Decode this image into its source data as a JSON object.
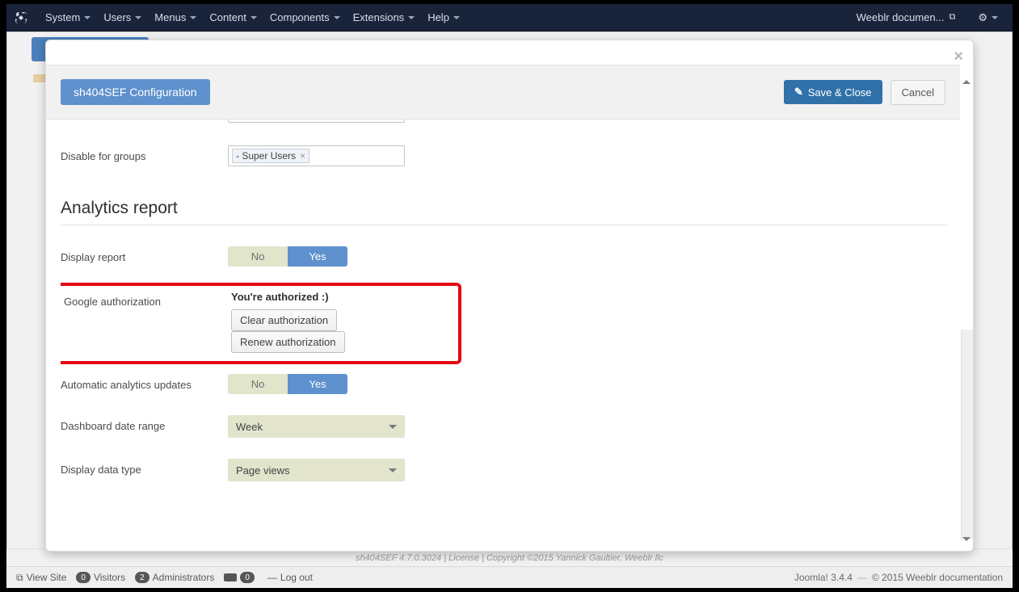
{
  "nav": {
    "items": [
      "System",
      "Users",
      "Menus",
      "Content",
      "Components",
      "Extensions",
      "Help"
    ],
    "right_label": "Weeblr documen...",
    "gear_icon": "gear-icon"
  },
  "modal": {
    "title_button": "sh404SEF Configuration",
    "save_close": "Save & Close",
    "cancel": "Cancel"
  },
  "form": {
    "disable_for_groups": {
      "label": "Disable for groups",
      "token": "- Super Users",
      "token_x": "×"
    },
    "section_heading": "Analytics report",
    "display_report": {
      "label": "Display report",
      "no": "No",
      "yes": "Yes"
    },
    "google_auth": {
      "label": "Google authorization",
      "status": "You're authorized :)",
      "clear": "Clear authorization",
      "renew": "Renew authorization"
    },
    "auto_updates": {
      "label": "Automatic analytics updates",
      "no": "No",
      "yes": "Yes"
    },
    "dash_range": {
      "label": "Dashboard date range",
      "value": "Week"
    },
    "data_type": {
      "label": "Display data type",
      "value": "Page views"
    }
  },
  "footer": {
    "info_line": "sh404SEF 4.7.0.3024 | License | Copyright ©2015 Yannick Gaultier, Weeblr llc",
    "view_site": "View Site",
    "visitors_count": "0",
    "visitors": "Visitors",
    "admins_count": "2",
    "admins": "Administrators",
    "msg_count": "0",
    "logout": "Log out",
    "right_version": "Joomla! 3.4.4",
    "right_copy": "© 2015 Weeblr documentation"
  }
}
